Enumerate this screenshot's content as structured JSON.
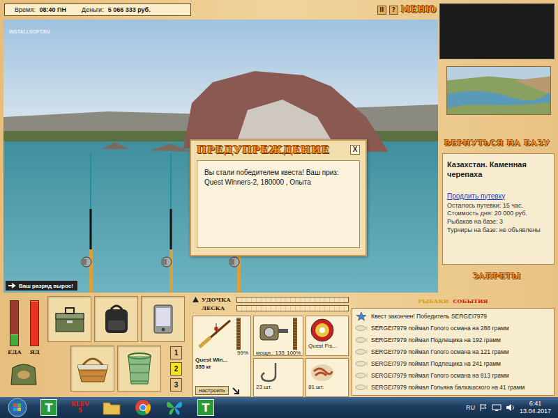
{
  "status": {
    "time_label": "Время:",
    "time": "08:40 ПН",
    "money_label": "Деньги:",
    "money": "5 066 333 руб."
  },
  "watermark": "INSTALLSOFT.RU",
  "top_buttons": [
    "II",
    "?"
  ],
  "menu": "МЕНЮ",
  "dialog": {
    "title": "ПРЕДУПРЕЖДЕНИЕ",
    "close": "X",
    "message": "Вы стали победителем квеста! Ваш приз: Quest Winners-2, 180000 , Опыта"
  },
  "notification": "Ваш разряд вырос!",
  "sidebar": {
    "return": "ВЕРНУТЬСЯ НА БАЗУ",
    "location": "Казахстан. Каменная черепаха",
    "extend_link": "Продлить путевку",
    "info": [
      "Осталось путевки: 15 час.",
      "Стоимость дня: 20 000 руб.",
      "Рыбаков на базе: 3",
      "Турниры на базе: не объявлены"
    ],
    "bans": "ЗАПРЕТЫ"
  },
  "meters": [
    {
      "label": "ЕДА",
      "level": 0.25,
      "color": "#3fae3a"
    },
    {
      "label": "ЯД",
      "level": 1,
      "color": "#e5331f"
    }
  ],
  "slot_tabs": [
    {
      "label": "1",
      "selected": false
    },
    {
      "label": "2",
      "selected": true
    },
    {
      "label": "3",
      "selected": false
    }
  ],
  "tension_bars": [
    {
      "label": "УДОЧКА",
      "level": 0
    },
    {
      "label": "ЛЕСКА",
      "level": 0
    }
  ],
  "rod": {
    "name": "Quest Win...",
    "weight": "355 кг",
    "durability": "99%",
    "level": 0.99,
    "button": "настроить"
  },
  "reel": {
    "power": "мощн.: 135",
    "durability": "100%",
    "level": 1
  },
  "line": {
    "name": "Quest Fis..."
  },
  "hook": {
    "count": "23 шт."
  },
  "bait": {
    "count": "81 шт."
  },
  "events": {
    "tabs": [
      {
        "label": "РЫБАКИ",
        "selected": false
      },
      {
        "label": "СОБЫТИЯ",
        "selected": true
      }
    ],
    "items": [
      {
        "kind": "star",
        "text": "Квест закончен! Победитель SERGEI7979"
      },
      {
        "kind": "fish",
        "text": "SERGEI7979 поймал Голого османа на 288 грамм"
      },
      {
        "kind": "fish",
        "text": "SERGEI7979 поймал Подлещика на 192 грамм"
      },
      {
        "kind": "fish",
        "text": "SERGEI7979 поймал Голого османа на 121 грамм"
      },
      {
        "kind": "fish",
        "text": "SERGEI7979 поймал Подлещика на 241 грамм"
      },
      {
        "kind": "fish",
        "text": "SERGEI7979 поймал Голого османа на 813 грамм"
      },
      {
        "kind": "fish",
        "text": "SERGEI7979 поймал Гольяна балхашского на 41 грамм"
      }
    ]
  },
  "taskbar": {
    "apps": [
      {
        "kind": "tile",
        "label": "T"
      },
      {
        "kind": "klev",
        "label": "KLEV 5"
      },
      {
        "kind": "folder",
        "label": ""
      },
      {
        "kind": "chrome",
        "label": ""
      },
      {
        "kind": "butterfly",
        "label": ""
      },
      {
        "kind": "tile",
        "label": "T"
      }
    ],
    "lang": "RU",
    "time": "6:41",
    "date": "13.04.2017"
  }
}
